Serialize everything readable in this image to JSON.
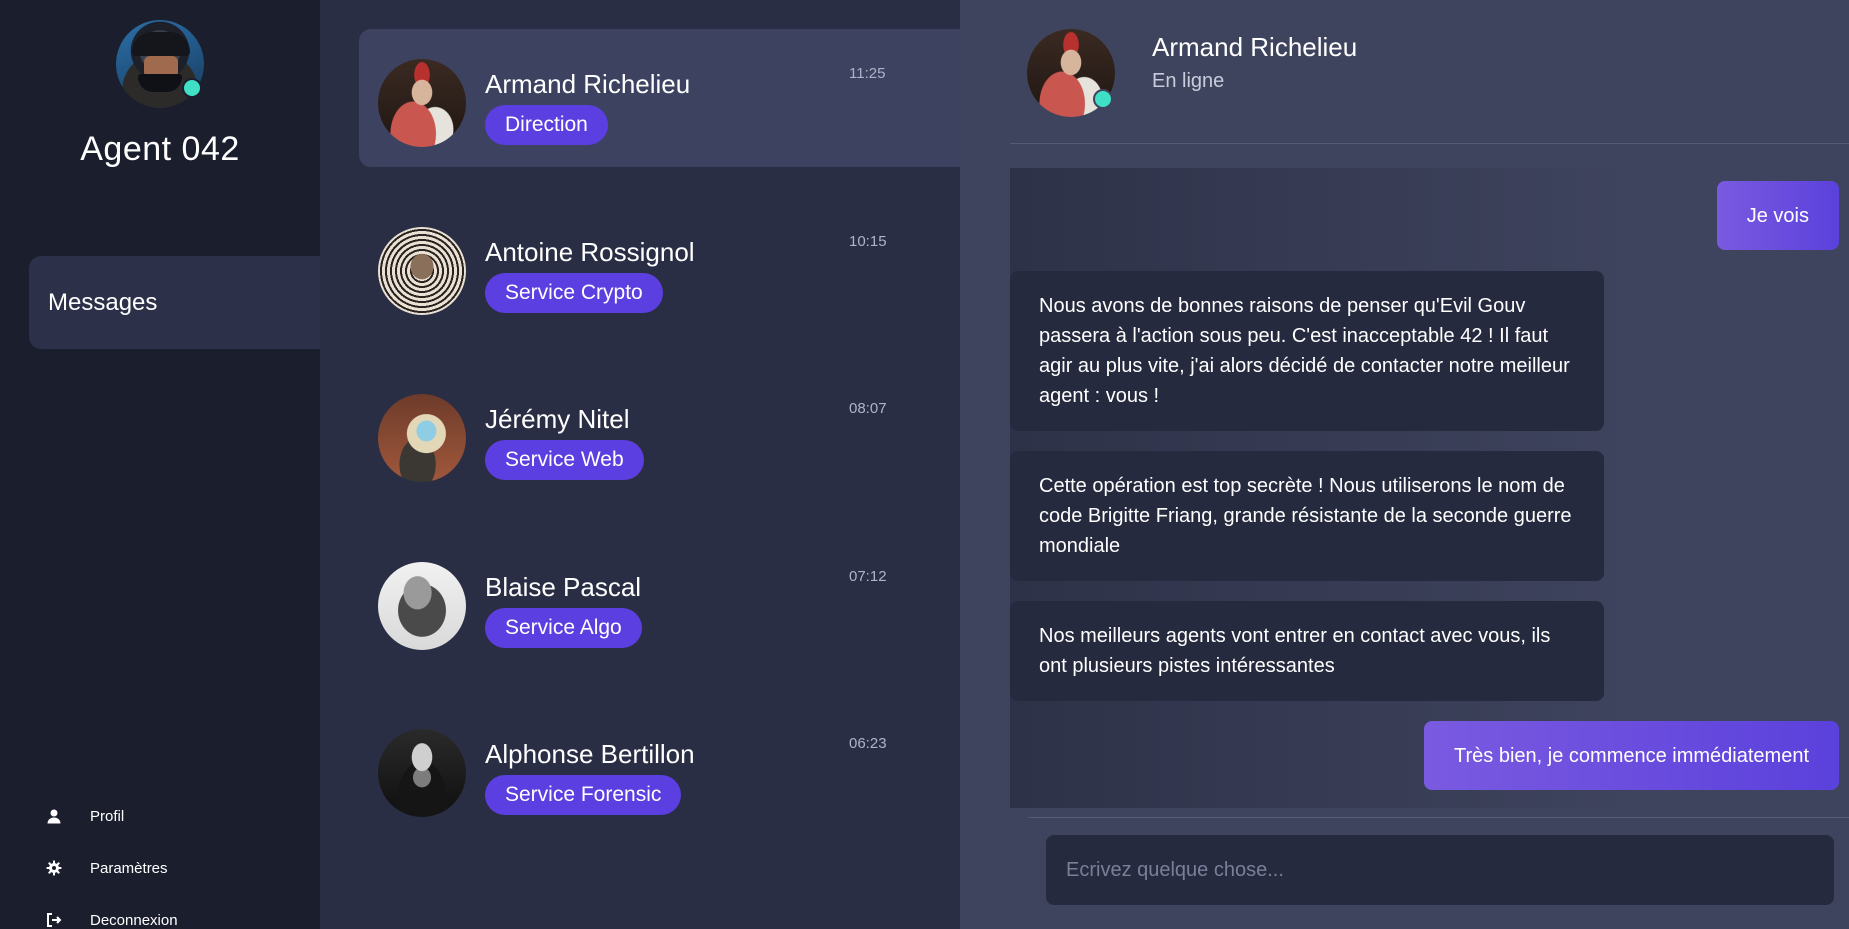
{
  "me": {
    "name": "Agent 042",
    "online": true
  },
  "nav": {
    "messages": "Messages",
    "bottom": [
      {
        "label": "Profil",
        "icon": "user-icon"
      },
      {
        "label": "Paramètres",
        "icon": "gear-icon"
      },
      {
        "label": "Deconnexion",
        "icon": "logout-icon"
      }
    ]
  },
  "conversations": [
    {
      "name": "Armand Richelieu",
      "tag": "Direction",
      "time": "11:25",
      "active": true
    },
    {
      "name": "Antoine Rossignol",
      "tag": "Service Crypto",
      "time": "10:15"
    },
    {
      "name": "Jérémy Nitel",
      "tag": "Service Web",
      "time": "08:07"
    },
    {
      "name": "Blaise Pascal",
      "tag": "Service Algo",
      "time": "07:12"
    },
    {
      "name": "Alphonse Bertillon",
      "tag": "Service Forensic",
      "time": "06:23"
    }
  ],
  "chat": {
    "name": "Armand Richelieu",
    "status": "En ligne",
    "messages": [
      {
        "from": "me",
        "text": "Je vois"
      },
      {
        "from": "them",
        "text": "Nous avons de bonnes raisons de penser qu'Evil Gouv passera à l'action sous peu. C'est inacceptable 42 ! Il faut agir au plus vite, j'ai alors décidé de contacter notre meilleur agent : vous !"
      },
      {
        "from": "them",
        "text": "Cette opération est top secrète ! Nous utiliserons le nom de code Brigitte Friang, grande résistante de la seconde guerre mondiale"
      },
      {
        "from": "them",
        "text": "Nos meilleurs agents vont entrer en contact avec vous, ils ont plusieurs pistes intéressantes"
      },
      {
        "from": "me",
        "text": "Très bien, je commence immédiatement"
      }
    ],
    "input_placeholder": "Ecrivez quelque chose..."
  },
  "colors": {
    "accent": "#5b3fe0",
    "online": "#3fe0c5",
    "sidebar_bg": "#1b1e2d",
    "list_bg": "#2a2e45",
    "chat_bg": "#3f445e"
  }
}
